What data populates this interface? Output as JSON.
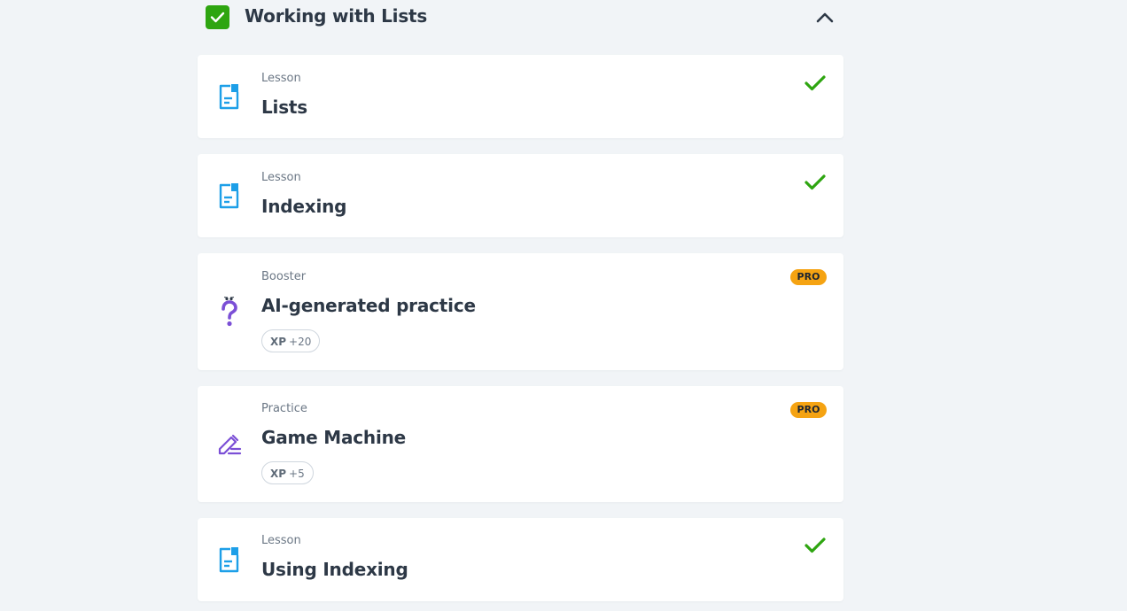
{
  "section": {
    "title": "Working with Lists",
    "collapse_icon": "chevron-up-icon",
    "status_icon": "checkbox-checked-icon"
  },
  "colors": {
    "background": "#f1f4f7",
    "card": "#ffffff",
    "success_green": "#2ea510",
    "pro_orange": "#f5a312",
    "lesson_blue": "#1d9fe8",
    "practice_purple": "#7b4fd6",
    "text_dark": "#2d3846",
    "text_muted": "#6b7785"
  },
  "items": [
    {
      "type": "Lesson",
      "title": "Lists",
      "icon": "lesson-document-icon",
      "completed": true
    },
    {
      "type": "Lesson",
      "title": "Indexing",
      "icon": "lesson-document-icon",
      "completed": true
    },
    {
      "type": "Booster",
      "title": "AI-generated practice",
      "icon": "question-mark-character-icon",
      "badge": "PRO",
      "xp_label": "XP",
      "xp_value": "+20"
    },
    {
      "type": "Practice",
      "title": "Game Machine",
      "icon": "pencil-edit-icon",
      "badge": "PRO",
      "xp_label": "XP",
      "xp_value": "+5"
    },
    {
      "type": "Lesson",
      "title": "Using Indexing",
      "icon": "lesson-document-icon",
      "completed": true
    }
  ]
}
